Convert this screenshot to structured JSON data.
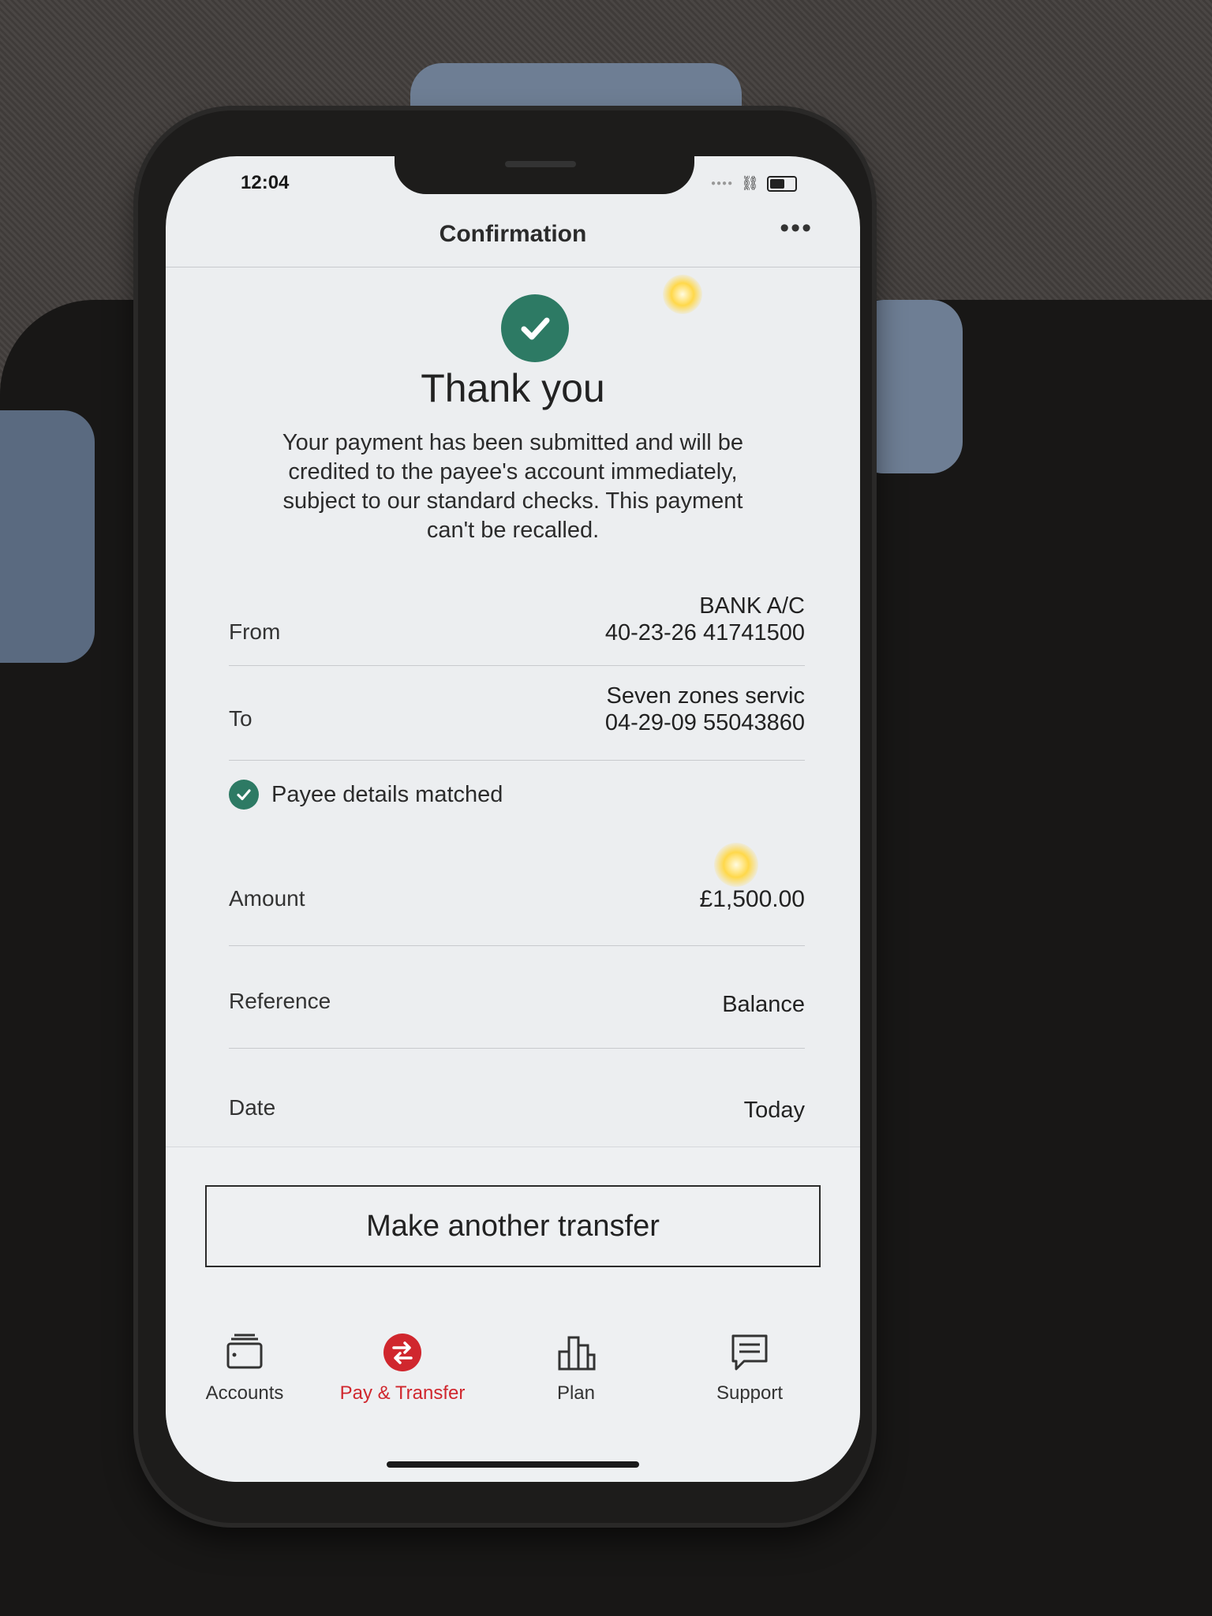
{
  "status_bar": {
    "time": "12:04"
  },
  "header": {
    "title": "Confirmation",
    "more_label": "•••"
  },
  "confirmation": {
    "title": "Thank you",
    "message": "Your payment has been submitted and will be credited to the payee's account immediately, subject to our standard checks. This payment can't be recalled."
  },
  "details": {
    "from": {
      "label": "From",
      "name": "BANK A/C",
      "account": "40-23-26 41741500"
    },
    "to": {
      "label": "To",
      "name": "Seven zones servic",
      "account": "04-29-09 55043860"
    },
    "payee_matched": "Payee details matched",
    "amount": {
      "label": "Amount",
      "value": "£1,500.00"
    },
    "reference": {
      "label": "Reference",
      "value": "Balance"
    },
    "date": {
      "label": "Date",
      "value": "Today"
    }
  },
  "actions": {
    "make_another_transfer": "Make another transfer"
  },
  "nav": [
    {
      "label": "Accounts",
      "icon": "wallet-icon"
    },
    {
      "label": "Pay & Transfer",
      "icon": "transfer-icon",
      "active": true
    },
    {
      "label": "Plan",
      "icon": "chart-icon"
    },
    {
      "label": "Support",
      "icon": "chat-icon"
    }
  ],
  "colors": {
    "success": "#2d7a64",
    "active_nav": "#d0272e"
  }
}
